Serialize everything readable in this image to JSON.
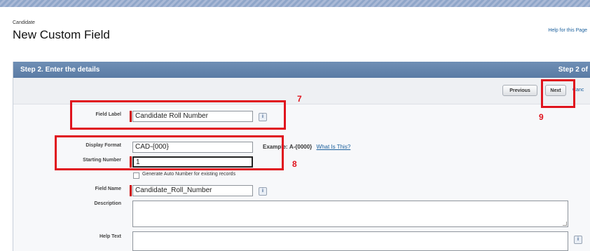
{
  "header": {
    "breadcrumb": "Candidate",
    "title": "New Custom Field",
    "help_link": "Help for this Page"
  },
  "step": {
    "title": "Step 2. Enter the details",
    "counter": "Step 2 of"
  },
  "buttons": {
    "previous": "Previous",
    "next": "Next",
    "cancel": "Canc"
  },
  "form": {
    "field_label": {
      "label": "Field Label",
      "value": "Candidate Roll Number"
    },
    "display_format": {
      "label": "Display Format",
      "value": "CAD-{000}",
      "example_prefix": "Example:",
      "example_value": "A-{0000}",
      "what_is_this": "What Is This?"
    },
    "starting_number": {
      "label": "Starting Number",
      "value": "1"
    },
    "generate_checkbox_label": "Generate Auto Number for existing records",
    "field_name": {
      "label": "Field Name",
      "value": "Candidate_Roll_Number"
    },
    "description": {
      "label": "Description",
      "value": ""
    },
    "help_text": {
      "label": "Help Text",
      "value": ""
    },
    "info_glyph": "i"
  },
  "annotations": {
    "callout_7": "7",
    "callout_8": "8",
    "callout_9": "9",
    "color": "#e0141e"
  }
}
